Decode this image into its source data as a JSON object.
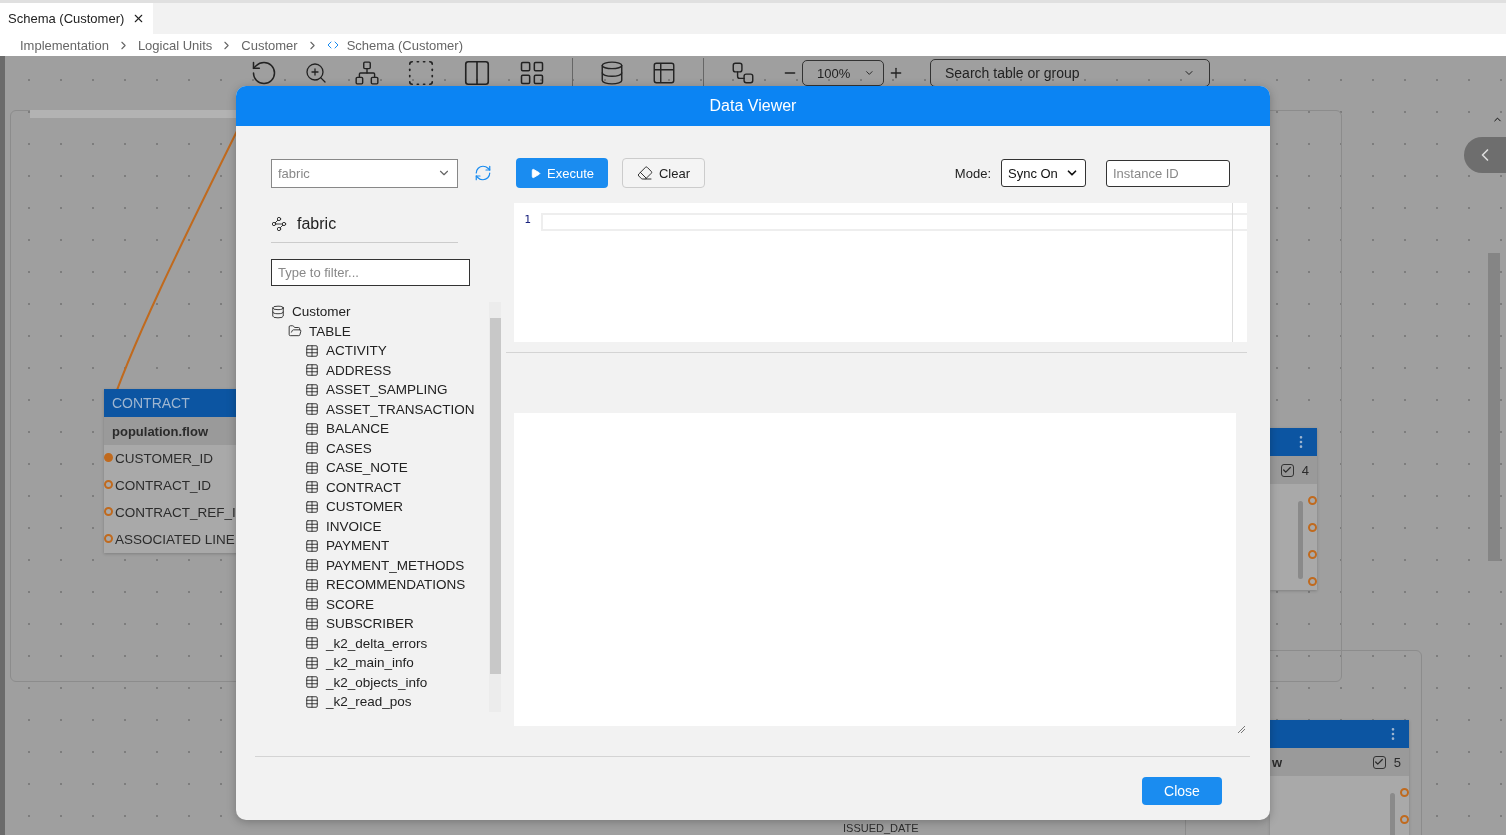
{
  "tab": {
    "title": "Schema (Customer)",
    "selected": true
  },
  "breadcrumb": [
    {
      "label": "Implementation",
      "kind": "link"
    },
    {
      "label": "Logical Units",
      "kind": "link"
    },
    {
      "label": "Customer",
      "kind": "link"
    },
    {
      "label": "Schema (Customer)",
      "kind": "schema"
    }
  ],
  "toolbar": {
    "zoom": "100%",
    "search": {
      "placeholder": "Search table or group"
    }
  },
  "canvas": {
    "nodes": [
      {
        "kind": "table",
        "title": "CONTRACT",
        "subtitle": "population.flow",
        "fields": [
          {
            "name": "CUSTOMER_ID",
            "linked": true
          },
          {
            "name": "CONTRACT_ID",
            "linked": false
          },
          {
            "name": "CONTRACT_REF_I",
            "linked": false
          },
          {
            "name": "ASSOCIATED LINE",
            "linked": false
          }
        ]
      },
      {
        "kind": "stub",
        "checked": true,
        "count": "4"
      },
      {
        "kind": "stub",
        "subtitle": "w",
        "checked": true,
        "count": "5"
      }
    ],
    "labels": [
      "ISSUED_DATE"
    ]
  },
  "dialog": {
    "title": "Data Viewer",
    "source": {
      "value": "fabric"
    },
    "execute": "Execute",
    "clear": "Clear",
    "mode": {
      "label": "Mode:",
      "value": "Sync On"
    },
    "instance": {
      "placeholder": "Instance ID"
    },
    "tree_title": "fabric",
    "filter": {
      "placeholder": "Type to filter..."
    },
    "tree": [
      {
        "label": "Customer",
        "kind": "database",
        "children": [
          {
            "label": "TABLE",
            "kind": "folder",
            "expanded": true,
            "children": [
              {
                "label": "ACTIVITY",
                "kind": "table"
              },
              {
                "label": "ADDRESS",
                "kind": "table"
              },
              {
                "label": "ASSET_SAMPLING",
                "kind": "table"
              },
              {
                "label": "ASSET_TRANSACTION",
                "kind": "table"
              },
              {
                "label": "BALANCE",
                "kind": "table"
              },
              {
                "label": "CASES",
                "kind": "table"
              },
              {
                "label": "CASE_NOTE",
                "kind": "table"
              },
              {
                "label": "CONTRACT",
                "kind": "table"
              },
              {
                "label": "CUSTOMER",
                "kind": "table"
              },
              {
                "label": "INVOICE",
                "kind": "table"
              },
              {
                "label": "PAYMENT",
                "kind": "table"
              },
              {
                "label": "PAYMENT_METHODS",
                "kind": "table"
              },
              {
                "label": "RECOMMENDATIONS",
                "kind": "table"
              },
              {
                "label": "SCORE",
                "kind": "table"
              },
              {
                "label": "SUBSCRIBER",
                "kind": "table"
              },
              {
                "label": "_k2_delta_errors",
                "kind": "table"
              },
              {
                "label": "_k2_main_info",
                "kind": "table"
              },
              {
                "label": "_k2_objects_info",
                "kind": "table"
              },
              {
                "label": "_k2_read_pos",
                "kind": "table"
              }
            ]
          }
        ]
      }
    ],
    "editor": {
      "lines": [
        "1"
      ]
    },
    "close": "Close"
  }
}
